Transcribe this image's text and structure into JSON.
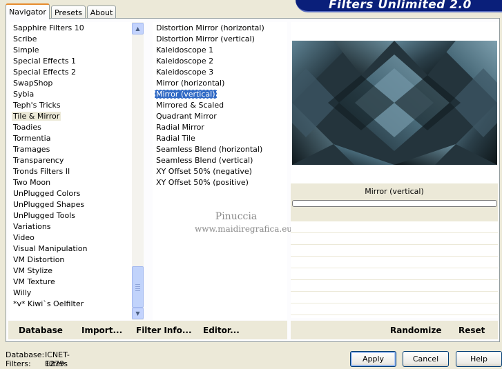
{
  "banner": {
    "title": "Filters Unlimited 2.0"
  },
  "tabs": [
    {
      "label": "Navigator",
      "active": true
    },
    {
      "label": "Presets",
      "active": false
    },
    {
      "label": "About",
      "active": false
    }
  ],
  "categories": {
    "items": [
      "Sapphire Filters 10",
      "Scribe",
      "Simple",
      "Special Effects 1",
      "Special Effects 2",
      "SwapShop",
      "Sybia",
      "Teph's Tricks",
      "Tile & Mirror",
      "Toadies",
      "Tormentia",
      "Tramages",
      "Transparency",
      "Tronds Filters II",
      "Two Moon",
      "UnPlugged Colors",
      "UnPlugged Shapes",
      "UnPlugged Tools",
      "Variations",
      "Video",
      "Visual Manipulation",
      "VM Distortion",
      "VM Stylize",
      "VM Texture",
      "Willy",
      "*v* Kiwi`s Oelfilter"
    ],
    "selected": "Tile & Mirror"
  },
  "filters": {
    "items": [
      "Distortion Mirror (horizontal)",
      "Distortion Mirror (vertical)",
      "Kaleidoscope 1",
      "Kaleidoscope 2",
      "Kaleidoscope 3",
      "Mirror (horizontal)",
      "Mirror (vertical)",
      "Mirrored & Scaled",
      "Quadrant Mirror",
      "Radial Mirror",
      "Radial Tile",
      "Seamless Blend (horizontal)",
      "Seamless Blend (vertical)",
      "XY Offset 50% (negative)",
      "XY Offset 50% (positive)"
    ],
    "selected": "Mirror (vertical)"
  },
  "watermark": {
    "line1": "Pinuccia",
    "line2": "www.maidiregrafica.eu"
  },
  "preview": {
    "filter_name": "Mirror (vertical)",
    "progress": 0
  },
  "left_buttons": {
    "database": "Database",
    "import": "Import...",
    "filter_info": "Filter Info...",
    "editor": "Editor..."
  },
  "right_buttons": {
    "randomize": "Randomize",
    "reset": "Reset"
  },
  "footer": {
    "database_label": "Database:",
    "database_value": "ICNET-Filters",
    "filters_label": "Filters:",
    "filters_value": "1279",
    "apply": "Apply",
    "cancel": "Cancel",
    "help": "Help"
  },
  "colors": {
    "selection": "#316ac5",
    "banner": "#0a1f7a",
    "face": "#ece9d8"
  }
}
